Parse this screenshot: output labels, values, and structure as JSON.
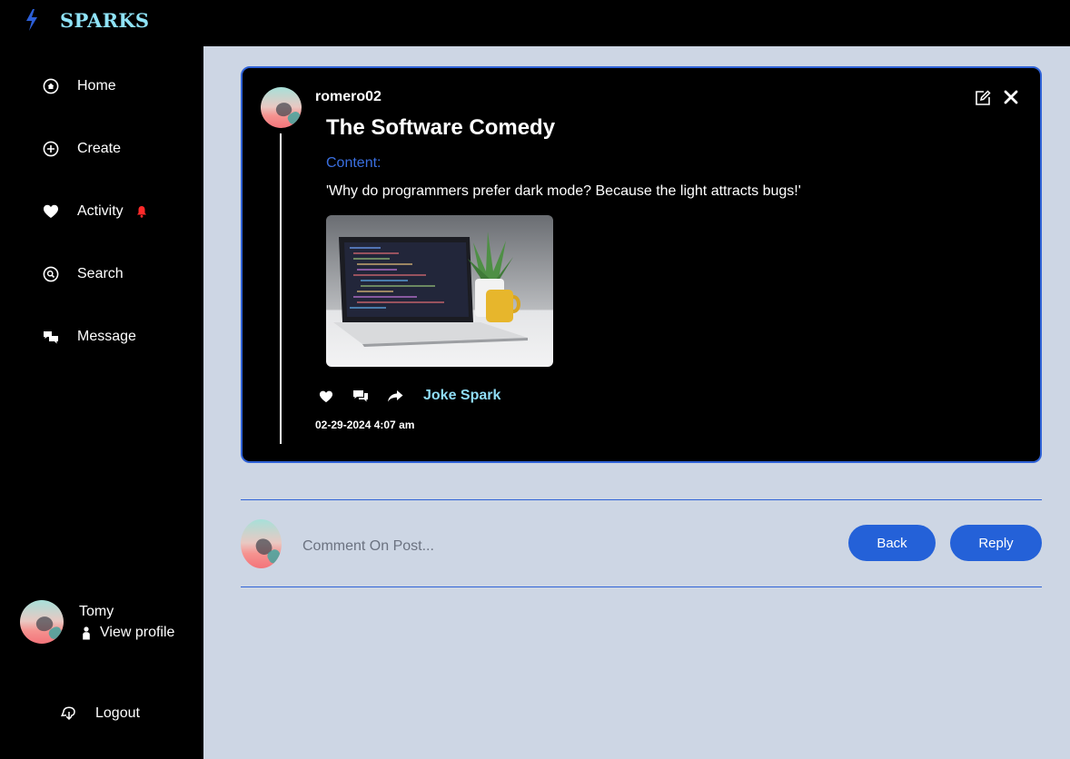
{
  "app": {
    "brand": "SPARKS",
    "colors": {
      "accent": "#2461d8",
      "brand_text": "#8fe3f7",
      "tag": "#8fdcf5",
      "notification": "#ff2a2a"
    }
  },
  "sidebar": {
    "items": [
      {
        "label": "Home",
        "icon": "home-icon"
      },
      {
        "label": "Create",
        "icon": "plus-circle-icon"
      },
      {
        "label": "Activity",
        "icon": "heart-icon",
        "badge_icon": "bell-icon"
      },
      {
        "label": "Search",
        "icon": "search-icon"
      },
      {
        "label": "Message",
        "icon": "chat-icon"
      }
    ],
    "profile": {
      "name": "Tomy",
      "view_label": "View profile"
    },
    "logout_label": "Logout"
  },
  "post": {
    "author": "romero02",
    "title": "The Software Comedy",
    "content_label": "Content:",
    "content": "'Why do programmers prefer dark mode? Because the light attracts bugs!'",
    "tag": "Joke Spark",
    "timestamp": "02-29-2024 4:07 am",
    "image_subject": "laptop with code on desk"
  },
  "comment": {
    "placeholder": "Comment On Post...",
    "back_label": "Back",
    "reply_label": "Reply"
  }
}
